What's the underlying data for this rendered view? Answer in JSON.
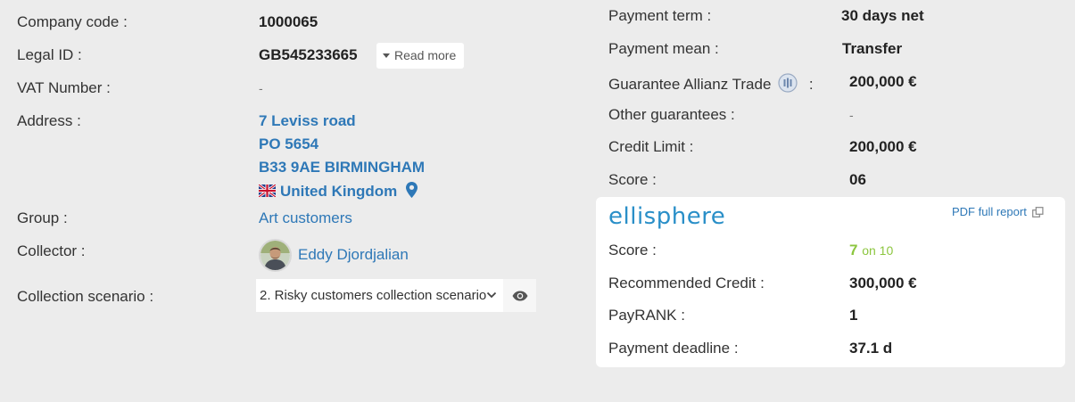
{
  "left": {
    "company_code_label": "Company code :",
    "company_code_value": "1000065",
    "legal_id_label": "Legal ID :",
    "legal_id_value": "GB545233665",
    "read_more": "Read more",
    "vat_label": "VAT Number :",
    "vat_value": "-",
    "address_label": "Address :",
    "address_line1": "7 Leviss road",
    "address_line2": "PO 5654",
    "address_line3": "B33 9AE BIRMINGHAM",
    "address_country": "United Kingdom",
    "group_label": "Group :",
    "group_value": "Art customers",
    "collector_label": "Collector :",
    "collector_value": "Eddy Djordjalian",
    "scenario_label": "Collection scenario :",
    "scenario_value": "2. Risky customers collection scenario"
  },
  "right": {
    "payment_term_label": "Payment term :",
    "payment_term_value": "30 days net",
    "payment_mean_label": "Payment mean :",
    "payment_mean_value": "Transfer",
    "guarantee_label": "Guarantee Allianz Trade",
    "guarantee_colon": ":",
    "guarantee_value": "200,000 €",
    "other_guarantees_label": "Other guarantees :",
    "other_guarantees_value": "-",
    "credit_limit_label": "Credit Limit :",
    "credit_limit_value": "200,000 €",
    "score_label": "Score :",
    "score_value": "06"
  },
  "card": {
    "logo_text": "ellisphere",
    "pdf_link": "PDF full report",
    "score_label": "Score :",
    "score_value": "7",
    "score_of": "on 10",
    "recommended_label": "Recommended Credit :",
    "recommended_value": "300,000 €",
    "payrank_label": "PayRANK :",
    "payrank_value": "1",
    "deadline_label": "Payment deadline :",
    "deadline_value": "37.1 d"
  },
  "colors": {
    "background": "#ececec",
    "link": "#2e78b7",
    "score_green": "#8cc63f",
    "logo_blue": "#2a8fc8"
  }
}
